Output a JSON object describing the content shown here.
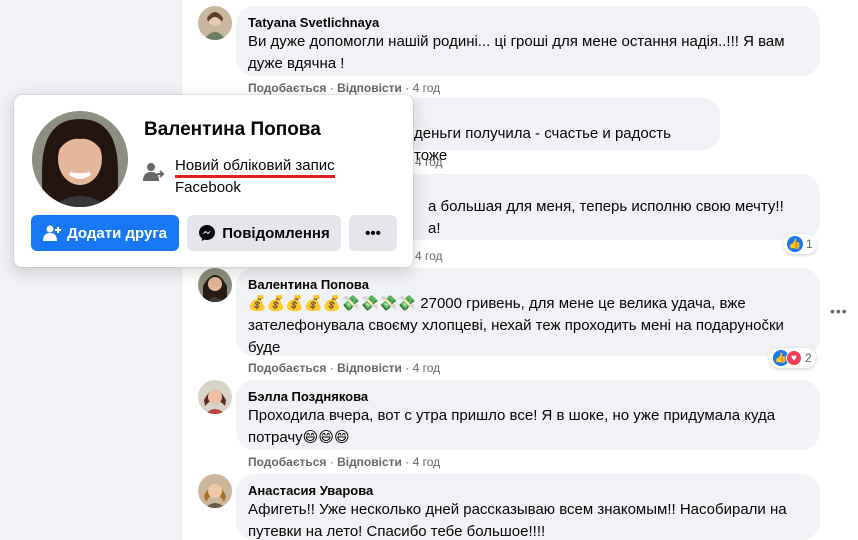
{
  "colors": {
    "accent": "#1877f2",
    "link_underline": "#e02020",
    "bubble_bg": "#f0f2f5",
    "meta_text": "#65676b"
  },
  "comments": [
    {
      "author": "Tatyana Svetlichnaya",
      "text_line1": "Ви дуже допомогли нашій родині... ці гроші для мене остання надія..!!! Я вам",
      "text_line2": "дуже вдячна !",
      "like": "Подобається",
      "reply": "Відповісти",
      "time": "4 год"
    },
    {
      "author": "",
      "text_line1": "деньги получила - счастье и радость тоже",
      "like": "",
      "reply": "",
      "time": "4 год"
    },
    {
      "author": "",
      "text_line1": "а большая для меня, теперь исполню свою мечту!!",
      "text_line2": "а!",
      "time": "4 год",
      "reaction_count": "1"
    },
    {
      "author": "Валентина Попова",
      "text_emoji": "💰💰💰💰💰💸💸💸💸",
      "text_line1": " 27000 гривень, для мене це велика удача, вже",
      "text_line2": "зателефонувала своєму хлопцеві, нехай теж проходить мені на подарунočки",
      "text_line3": "буде",
      "like": "Подобається",
      "reply": "Відповісти",
      "time": "4 год",
      "reaction_count": "2"
    },
    {
      "author": "Бэлла Позднякова",
      "text_line1": "Проходила вчера, вот с утра пришло все! Я в шоке, но уже придумала куда",
      "text_line2": "потрачу😄😄😄",
      "like": "Подобається",
      "reply": "Відповісти",
      "time": "4 год"
    },
    {
      "author": "Анастасия Уварова",
      "text_line1": "Афигеть!! Уже несколько дней рассказываю всем знакомым!! Насобирали на",
      "text_line2": "путевки на лето! Спасибо тебе большое!!!!"
    }
  ],
  "hover_card": {
    "name": "Валентина Попова",
    "link_text": "Новий обліковий запис",
    "sub_text": "Facebook",
    "add_friend": "Додати друга",
    "message": "Повідомлення",
    "more": "•••"
  },
  "icons": {
    "add_friend": "person-plus-icon",
    "messenger": "messenger-icon",
    "account": "person-arrow-icon",
    "more": "more-dots-icon"
  }
}
